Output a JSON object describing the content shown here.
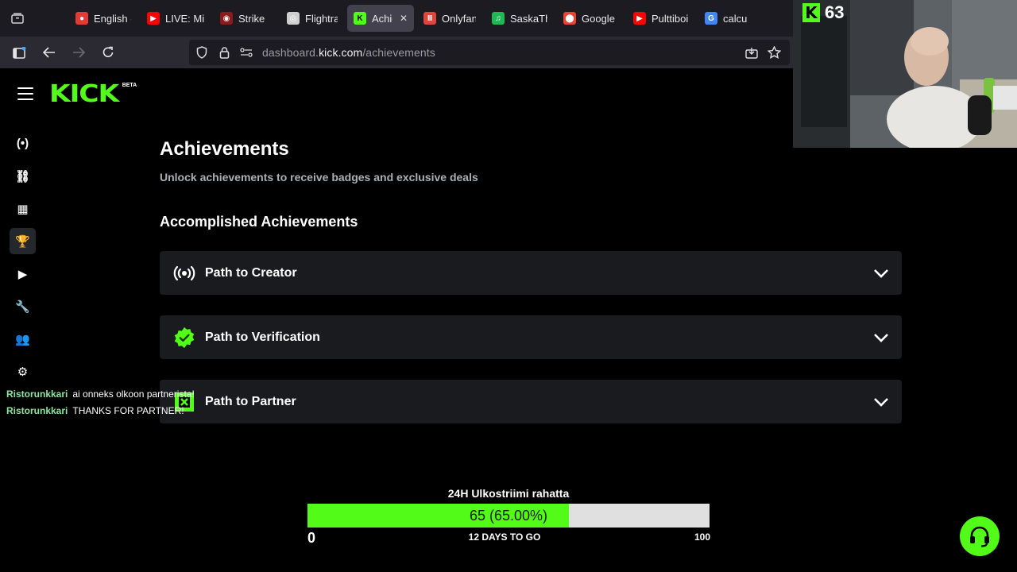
{
  "browser": {
    "tabs": [
      {
        "label": "English -",
        "favicon": "red-circle",
        "color": "#e53935",
        "active": false
      },
      {
        "label": "LIVE: Mic",
        "favicon": "youtube-icon",
        "color": "#ff0000",
        "active": false
      },
      {
        "label": "Strike",
        "favicon": "audio-icon",
        "color": "#8b1a1a",
        "active": false
      },
      {
        "label": "Flightrad",
        "favicon": "radar-icon",
        "color": "#cfcfcf",
        "active": false
      },
      {
        "label": "Achie",
        "favicon": "kick-icon",
        "color": "#53fc18",
        "active": true
      },
      {
        "label": "Onlyfans",
        "favicon": "onlyfans-icon",
        "color": "#e0443a",
        "active": false
      },
      {
        "label": "SaskaTh",
        "favicon": "spotify-icon",
        "color": "#1db954",
        "active": false
      },
      {
        "label": "Google I",
        "favicon": "maps-icon",
        "color": "#ea4335",
        "active": false
      },
      {
        "label": "Pulttiboi",
        "favicon": "youtube-icon",
        "color": "#ff0000",
        "active": false
      },
      {
        "label": "calculat",
        "favicon": "google-icon",
        "color": "#4285f4",
        "active": false
      }
    ],
    "active_tab_close": "✕",
    "url_host": "dashboard.",
    "url_domain": "kick.com",
    "url_path": "/achievements"
  },
  "kick": {
    "logo_text": "KICK",
    "logo_badge": "BETA",
    "nav_items": [
      {
        "name": "live-icon",
        "glyph": "(•)",
        "active": false
      },
      {
        "name": "link-icon",
        "glyph": "⛓",
        "active": false
      },
      {
        "name": "analytics-icon",
        "glyph": "▦",
        "active": false
      },
      {
        "name": "trophy-icon",
        "glyph": "🏆",
        "active": true
      },
      {
        "name": "media-icon",
        "glyph": "▶",
        "active": false
      },
      {
        "name": "wrench-icon",
        "glyph": "🔧",
        "active": false
      },
      {
        "name": "community-icon",
        "glyph": "👥",
        "active": false
      },
      {
        "name": "tools-icon",
        "glyph": "⚙",
        "active": false
      }
    ]
  },
  "achievements": {
    "title": "Achievements",
    "subtitle": "Unlock achievements to receive badges and exclusive deals",
    "section_title": "Accomplished Achievements",
    "items": [
      {
        "title": "Path to Creator",
        "icon": "broadcast-icon"
      },
      {
        "title": "Path to Verification",
        "icon": "verified-badge-icon"
      },
      {
        "title": "Path to Partner",
        "icon": "partner-icon"
      }
    ]
  },
  "chat": [
    {
      "user": "Ristorunkkari",
      "message": "ai onneks olkoon partnerista!"
    },
    {
      "user": "Ristorunkkari",
      "message": "THANKS FOR PARTNER!"
    }
  ],
  "goal": {
    "title": "24H Ulkostriimi rahatta",
    "value_text": "65 (65.00%)",
    "progress": 0.65,
    "min": "0",
    "max": "100",
    "days_text": "12 DAYS TO GO"
  },
  "overlay": {
    "kick_badge": "K",
    "viewer_count": "63"
  },
  "colors": {
    "accent": "#53fc18",
    "card": "#191b1f",
    "subtitle": "#a9b0b6"
  }
}
